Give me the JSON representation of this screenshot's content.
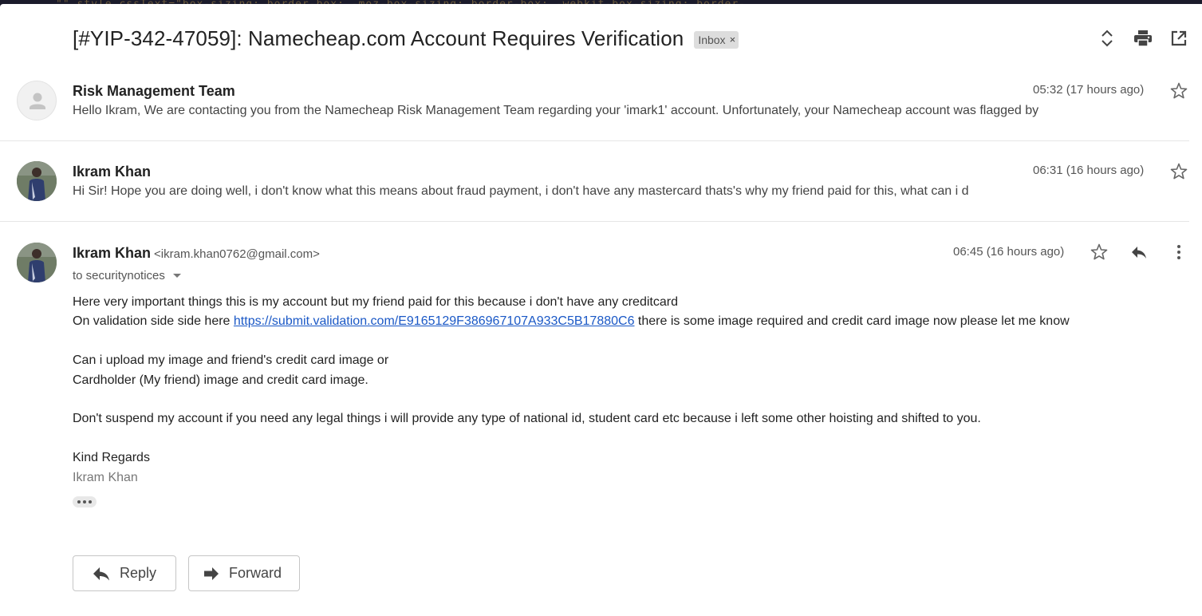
{
  "email": {
    "subject": "[#YIP-342-47059]: Namecheap.com Account Requires Verification",
    "label_chip": "Inbox",
    "label_chip_close": "×"
  },
  "messages": [
    {
      "sender": "Risk Management Team",
      "time": "05:32 (17 hours ago)",
      "snippet": "Hello Ikram, We are contacting you from the Namecheap Risk Management Team regarding your 'imark1' account. Unfortunately, your Namecheap account was flagged by"
    },
    {
      "sender": "Ikram Khan",
      "time": "06:31 (16 hours ago)",
      "snippet": "Hi Sir! Hope you are doing well, i don't know what this means about fraud payment, i don't have any mastercard thats's why my friend paid for this, what can i d"
    }
  ],
  "open_message": {
    "sender": "Ikram Khan",
    "email": "<ikram.khan0762@gmail.com>",
    "time": "06:45 (16 hours ago)",
    "to": "to securitynotices",
    "body": {
      "line1": "Here very important things this is my account but my friend paid for this because i don't have any creditcard",
      "line2_prefix": "On validation side side here ",
      "link": "https://submit.validation.com/E9165129F386967107A933C5B17880C6",
      "line2_suffix": " there is some image required and credit card image now please let me know",
      "line3": "Can i upload my image and friend's credit card image or",
      "line4": "Cardholder (My friend) image and credit card image.",
      "line5": "Don't suspend my account if you need any legal things i will provide any type of national id, student card etc because i left some other hoisting and shifted to you.",
      "closing": "Kind Regards",
      "signature": "Ikram Khan"
    }
  },
  "actions": {
    "reply": "Reply",
    "forward": "Forward"
  },
  "background_code": "\"\"   style cssText=\"box-sizing: border-box; -moz-box-sizing: border-box; -webkit-box-sizing: border-"
}
